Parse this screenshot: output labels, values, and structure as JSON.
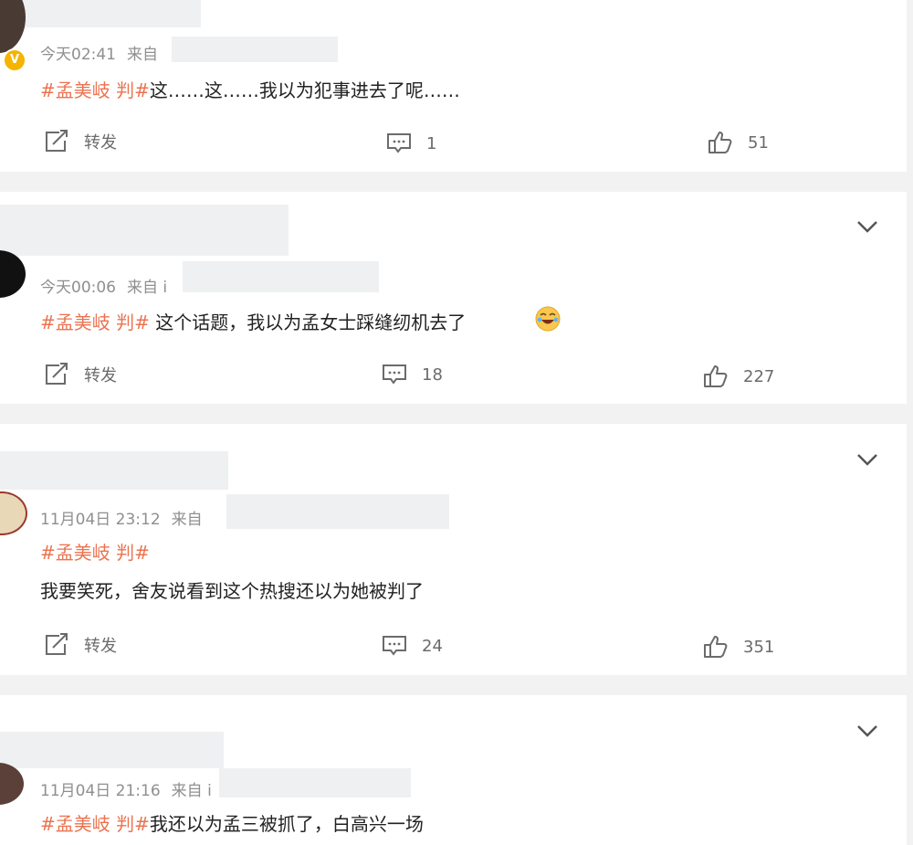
{
  "posts": [
    {
      "time": "今天02:41",
      "source_prefix": "来自",
      "hashtag": "#孟美岐 判#",
      "text": "这……这……我以为犯事进去了呢……",
      "repost_label": "转发",
      "comments": "1",
      "likes": "51"
    },
    {
      "time": "今天00:06",
      "source_prefix": "来自 i",
      "hashtag": "#孟美岐 判#",
      "text": " 这个话题，我以为孟女士踩缝纫机去了",
      "repost_label": "转发",
      "comments": "18",
      "likes": "227"
    },
    {
      "time": "11月04日 23:12",
      "source_prefix": "来自",
      "hashtag": "#孟美岐 判#",
      "text": "我要笑死，舍友说看到这个热搜还以为她被判了",
      "repost_label": "转发",
      "comments": "24",
      "likes": "351"
    },
    {
      "time": "11月04日 21:16",
      "source_prefix": "来自 i",
      "hashtag": "#孟美岐 判#",
      "text": "我还以为孟三被抓了，白高兴一场"
    }
  ],
  "icons": {
    "repost": "repost-icon",
    "comment": "comment-icon",
    "like": "like-icon",
    "more": "chevron-down-icon",
    "verified": "verified-badge-icon",
    "emoji": "laugh-cry-emoji"
  },
  "colors": {
    "hashtag": "#eb7350",
    "meta": "#8f8f8f",
    "background": "#f2f2f2"
  },
  "badge_letter": "V"
}
